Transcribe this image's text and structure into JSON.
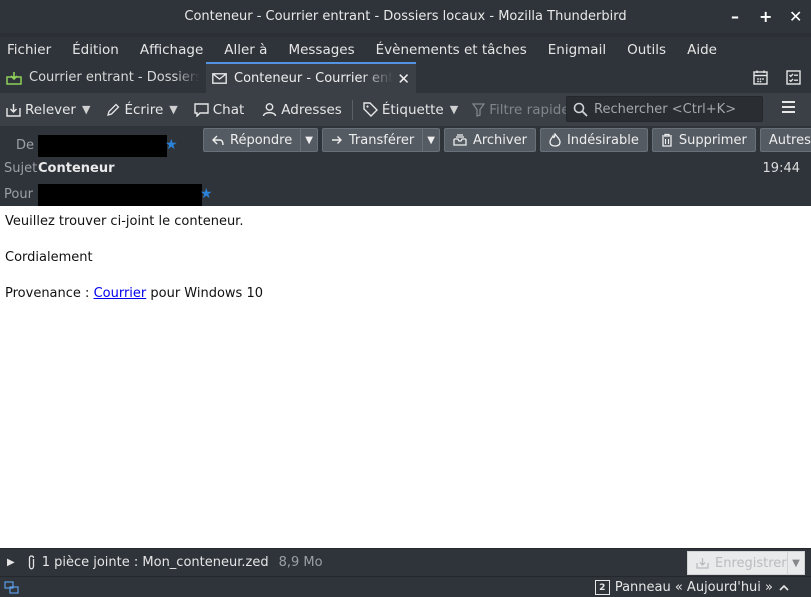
{
  "window": {
    "title": "Conteneur - Courrier entrant - Dossiers locaux - Mozilla Thunderbird",
    "minimize": "–",
    "maximize": "+",
    "close": "✕"
  },
  "menu": [
    "Fichier",
    "Édition",
    "Affichage",
    "Aller à",
    "Messages",
    "Évènements et tâches",
    "Enigmail",
    "Outils",
    "Aide"
  ],
  "tabs": [
    {
      "label": "Courrier entrant - Dossiers locaux",
      "icon": "inbox-icon"
    },
    {
      "label": "Conteneur - Courrier entrant",
      "icon": "envelope-icon",
      "close": "✕"
    }
  ],
  "toolbar": {
    "get_mail": "Relever",
    "write": "Écrire",
    "chat": "Chat",
    "address_book": "Adresses",
    "tag": "Étiquette",
    "quick_filter": "Filtre rapide",
    "search_placeholder": "Rechercher <Ctrl+K>"
  },
  "header": {
    "from_label": "De",
    "subject_label": "Sujet",
    "to_label": "Pour",
    "subject": "Conteneur",
    "time": "19:44",
    "reply": "Répondre",
    "forward": "Transférer",
    "archive": "Archiver",
    "junk": "Indésirable",
    "delete": "Supprimer",
    "other": "Autres"
  },
  "message": {
    "line1": "Veuillez trouver ci-joint le conteneur.",
    "line2": "Cordialement",
    "line3_prefix": "Provenance : ",
    "line3_link": "Courrier",
    "line3_suffix": " pour Windows 10"
  },
  "attachment": {
    "summary": "1 pièce jointe : Mon_conteneur.zed",
    "size": "8,9 Mo",
    "save": "Enregistrer"
  },
  "status": {
    "today_count": "2",
    "today_pane": "Panneau « Aujourd'hui »"
  },
  "colors": {
    "accent": "#5294e2",
    "star": "#2a82da",
    "link": "#0000ee"
  }
}
